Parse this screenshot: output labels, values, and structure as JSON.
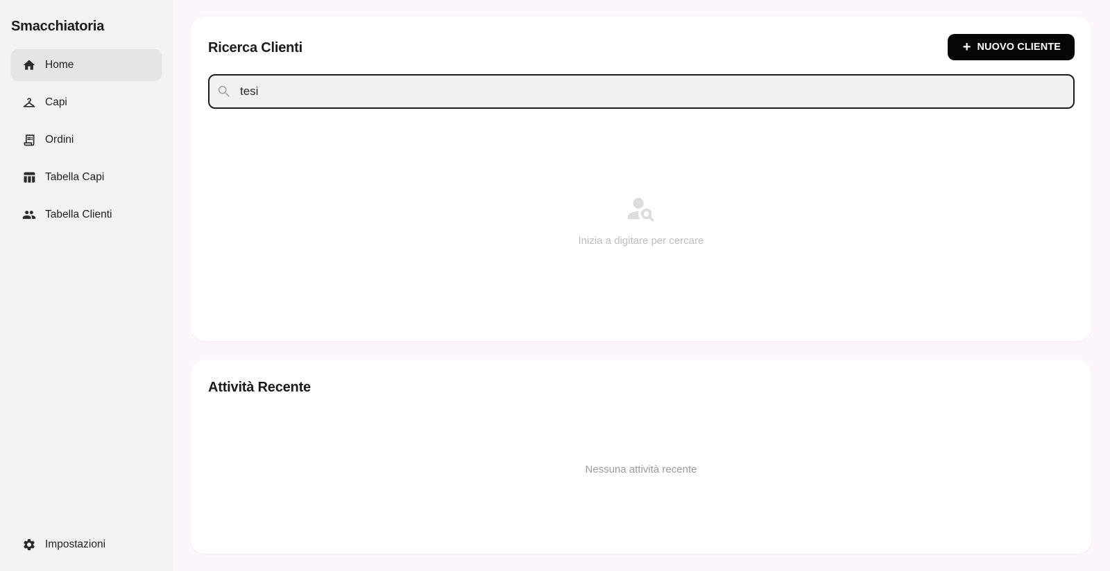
{
  "app": {
    "brand": "Smacchiatoria"
  },
  "sidebar": {
    "items": [
      {
        "label": "Home",
        "icon": "home-icon",
        "active": true
      },
      {
        "label": "Capi",
        "icon": "hanger-icon"
      },
      {
        "label": "Ordini",
        "icon": "receipt-icon"
      },
      {
        "label": "Tabella Capi",
        "icon": "table-icon"
      },
      {
        "label": "Tabella Clienti",
        "icon": "people-icon"
      }
    ],
    "settings": {
      "label": "Impostazioni",
      "icon": "gear-icon"
    }
  },
  "search": {
    "title": "Ricerca Clienti",
    "new_button_label": "NUOVO CLIENTE",
    "new_button_icon": "plus-icon",
    "query": "tesi",
    "empty_icon": "person-search-icon",
    "empty_text": "Inizia a digitare per cercare"
  },
  "recent": {
    "title": "Attività Recente",
    "empty_text": "Nessuna attività recente"
  },
  "colors": {
    "background": "#fcf6fc",
    "sidebar": "#f2f2f3",
    "accent_button": "#060606",
    "caret": "#5b4bd0"
  }
}
